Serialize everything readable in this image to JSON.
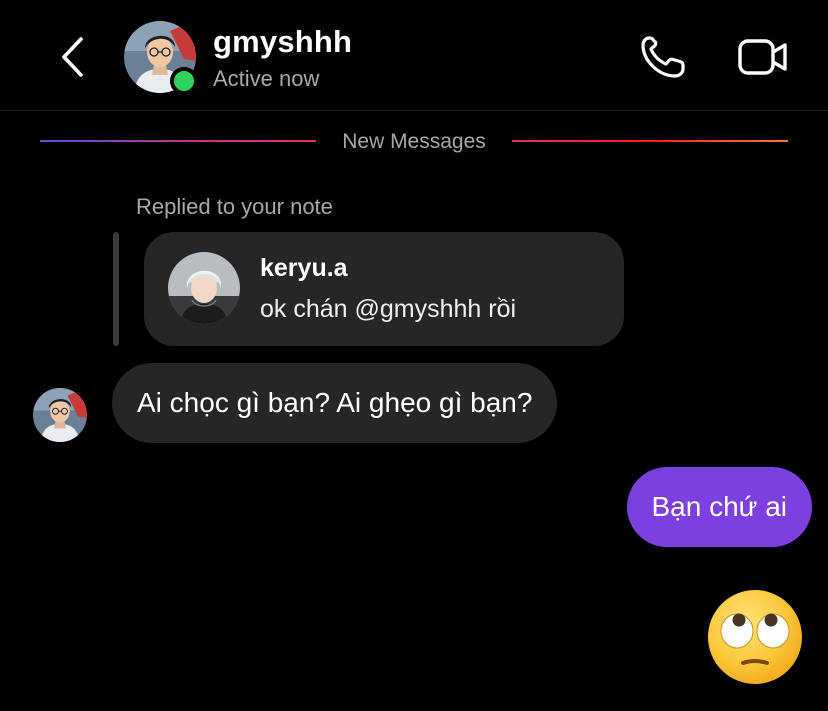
{
  "header": {
    "username": "gmyshhh",
    "status": "Active now",
    "online_dot_color": "#2fd25c",
    "icons": [
      "chevron-left-icon",
      "phone-icon",
      "video-camera-icon"
    ]
  },
  "divider": {
    "label": "New Messages"
  },
  "reply": {
    "label": "Replied to your note",
    "note_user": "keryu.a",
    "note_text": "ok chán @gmyshhh rồi"
  },
  "messages": [
    {
      "direction": "incoming",
      "text": "Ai chọc gì bạn? Ai ghẹo gì bạn?"
    },
    {
      "direction": "outgoing",
      "text": "Bạn chứ ai"
    },
    {
      "direction": "outgoing",
      "type": "emoji",
      "emoji": "face-with-rolling-eyes"
    }
  ],
  "colors": {
    "background": "#000000",
    "incoming_bubble": "#262626",
    "outgoing_bubble": "#7d3fe0",
    "secondary_text": "#a8a8a8"
  }
}
